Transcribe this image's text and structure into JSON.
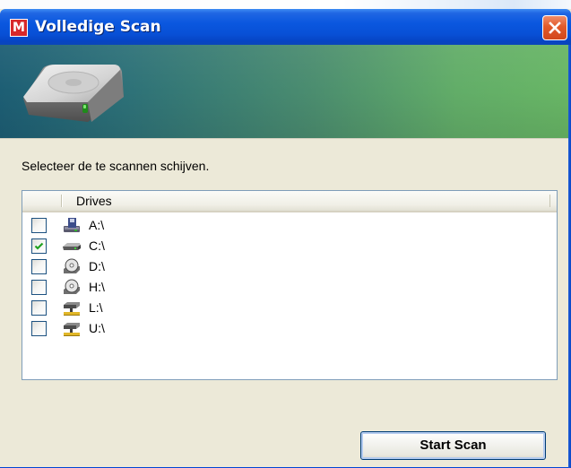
{
  "window": {
    "title": "Volledige Scan",
    "app_icon_letter": "M",
    "close_icon": "close-icon"
  },
  "content": {
    "instruction": "Selecteer de te scannen schijven.",
    "list": {
      "header": "Drives",
      "rows": [
        {
          "label": "A:\\",
          "checked": false,
          "icon": "floppy-drive-icon"
        },
        {
          "label": "C:\\",
          "checked": true,
          "icon": "hard-drive-icon"
        },
        {
          "label": "D:\\",
          "checked": false,
          "icon": "cd-drive-icon"
        },
        {
          "label": "H:\\",
          "checked": false,
          "icon": "cd-drive-icon"
        },
        {
          "label": "L:\\",
          "checked": false,
          "icon": "network-drive-icon"
        },
        {
          "label": "U:\\",
          "checked": false,
          "icon": "network-drive-icon"
        }
      ]
    },
    "start_button": "Start Scan"
  },
  "colors": {
    "titlebar": "#0a57df",
    "banner_start": "#1d5e74",
    "banner_end": "#68b665",
    "checkmark": "#21a121",
    "dialog_bg": "#ece9d8"
  }
}
